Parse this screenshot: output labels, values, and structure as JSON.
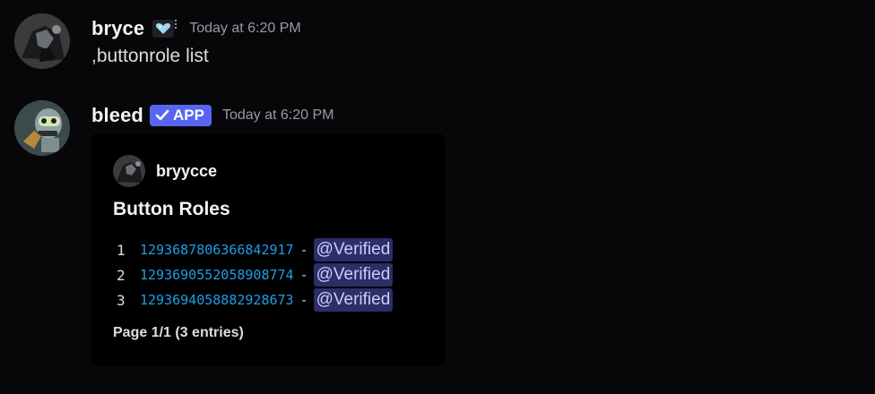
{
  "messages": [
    {
      "username": "bryce",
      "badge_icon": "heart-crystal-icon",
      "timestamp": "Today at 6:20 PM",
      "content": ",buttonrole list"
    },
    {
      "username": "bleed",
      "app_badge": "APP",
      "timestamp": "Today at 6:20 PM",
      "embed": {
        "author": "bryycce",
        "title": "Button Roles",
        "rows": [
          {
            "num": "1",
            "id": "1293687806366842917",
            "sep": "-",
            "role": "@Verified"
          },
          {
            "num": "2",
            "id": "1293690552058908774",
            "sep": "-",
            "role": "@Verified"
          },
          {
            "num": "3",
            "id": "1293694058882928673",
            "sep": "-",
            "role": "@Verified"
          }
        ],
        "footer": "Page 1/1 (3 entries)"
      }
    }
  ],
  "colors": {
    "background": "#070709",
    "embed_background": "#000000",
    "app_badge": "#5865f2",
    "link_id": "#1e9fe8",
    "mention_bg": "#2c2e68",
    "mention_text": "#c9cdfb",
    "timestamp": "#949ba4"
  }
}
